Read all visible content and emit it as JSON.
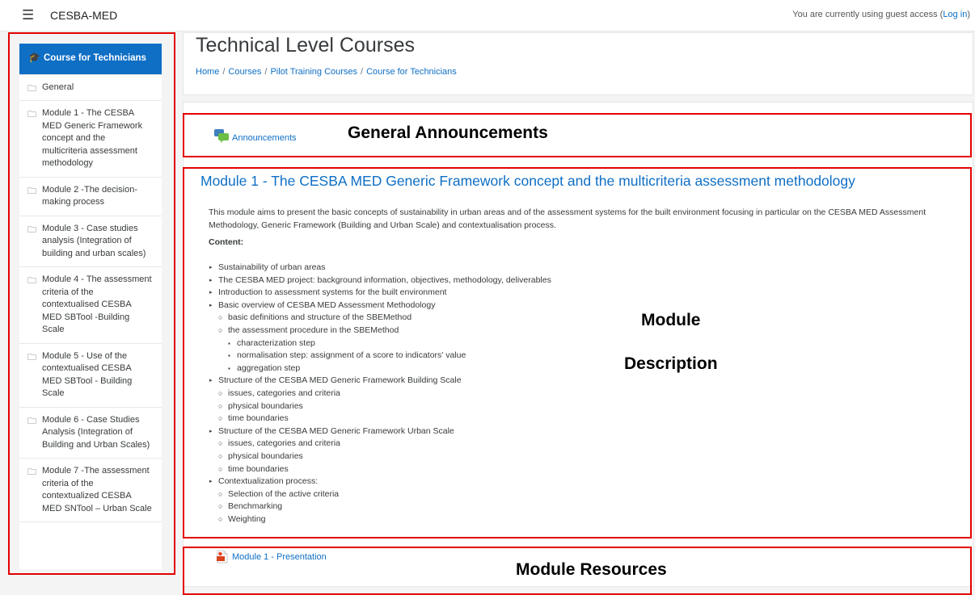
{
  "topbar": {
    "menu_icon": "hamburger-menu-icon",
    "site_name": "CESBA-MED",
    "guest_text": "You are currently using guest access (",
    "login_link": "Log in",
    "guest_close": ")"
  },
  "drawer": {
    "active_label": "Course for Technicians",
    "active_icon": "graduation-cap-icon",
    "items": [
      {
        "label": "General"
      },
      {
        "label": "Module 1 - The CESBA MED Generic Framework concept and the multicriteria assessment methodology"
      },
      {
        "label": "Module 2 -The decision-making process"
      },
      {
        "label": "Module 3 - Case studies analysis (Integration of building and urban scales)"
      },
      {
        "label": "Module 4 - The assessment criteria of the contextualised CESBA MED SBTool -Building Scale"
      },
      {
        "label": "Module 5 - Use of the contextualised CESBA MED SBTool - Building Scale"
      },
      {
        "label": "Module 6 - Case Studies Analysis (Integration of Building and Urban Scales)"
      },
      {
        "label": "Module 7 -The assessment criteria of the contextualized CESBA MED SNTool – Urban Scale"
      }
    ]
  },
  "header": {
    "title": "Technical Level Courses",
    "breadcrumb": [
      "Home",
      "Courses",
      "Pilot Training Courses",
      "Course for Technicians"
    ]
  },
  "general_section": {
    "announcements_label": "Announcements"
  },
  "annotations": {
    "general": "General Announcements",
    "module_line1": "Module",
    "module_line2": "Description",
    "resources": "Module Resources"
  },
  "module": {
    "title": "Module 1 - The CESBA MED Generic Framework concept and the multicriteria assessment methodology",
    "intro": "This module aims to present the basic concepts of sustainability in urban areas and of the assessment systems for the built environment focusing in particular on the CESBA MED Assessment Methodology, Generic Framework (Building and Urban Scale) and contextualisation process.",
    "content_label": "Content:",
    "items": [
      {
        "text": "Sustainability of urban areas",
        "level": 1
      },
      {
        "text": "The CESBA MED project: background information, objectives, methodology, deliverables",
        "level": 1
      },
      {
        "text": "Introduction to assessment systems for the built environment",
        "level": 1
      },
      {
        "text": "Basic overview of CESBA MED Assessment Methodology",
        "level": 1
      },
      {
        "text": "basic definitions and structure of the SBEMethod",
        "level": 2
      },
      {
        "text": "the assessment procedure in the SBEMethod",
        "level": 2
      },
      {
        "text": "characterization step",
        "level": 3
      },
      {
        "text": "normalisation step: assignment of a score to indicators' value",
        "level": 3
      },
      {
        "text": "aggregation step",
        "level": 3
      },
      {
        "text": "Structure of the CESBA MED Generic Framework Building Scale",
        "level": 1
      },
      {
        "text": "issues, categories and criteria",
        "level": 2
      },
      {
        "text": "physical boundaries",
        "level": 2
      },
      {
        "text": "time boundaries",
        "level": 2
      },
      {
        "text": "Structure of the CESBA MED Generic Framework Urban Scale",
        "level": 1
      },
      {
        "text": "issues, categories and criteria",
        "level": 2
      },
      {
        "text": "physical boundaries",
        "level": 2
      },
      {
        "text": "time boundaries",
        "level": 2
      },
      {
        "text": "Contextualization process:",
        "level": 1
      },
      {
        "text": "Selection of the active criteria",
        "level": 2
      },
      {
        "text": "Benchmarking",
        "level": 2
      },
      {
        "text": "Weighting",
        "level": 2
      }
    ]
  },
  "resources": {
    "presentation_label": "Module 1 - Presentation",
    "presentation_icon": "pdf-file-icon"
  },
  "colors": {
    "link": "#0f6fc5",
    "active_bg": "#0f6fc5",
    "highlight": "#e30000"
  }
}
